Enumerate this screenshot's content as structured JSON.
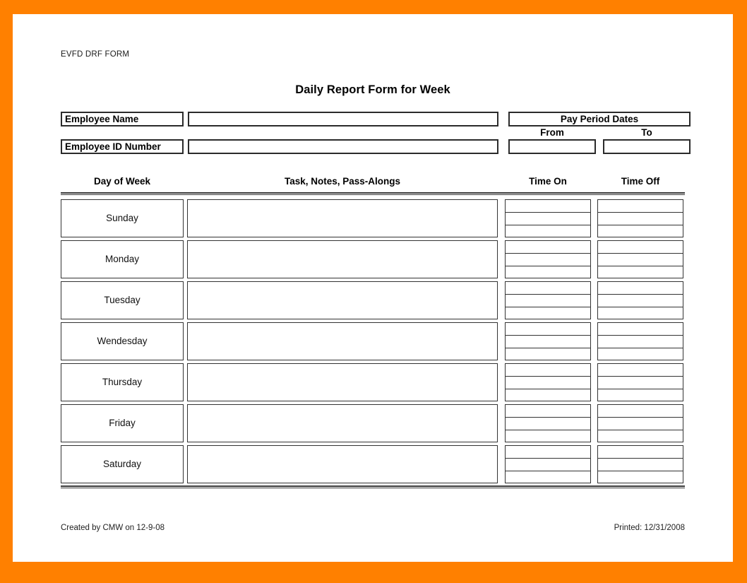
{
  "frame": {
    "border_color": "#ff8000",
    "page_color": "#ffffff"
  },
  "header": {
    "form_code": "EVFD DRF FORM",
    "title": "Daily Report Form for Week"
  },
  "identity": {
    "employee_name_label": "Employee Name",
    "employee_name_value": "",
    "employee_id_label": "Employee ID Number",
    "employee_id_value": "",
    "pay_period_title": "Pay Period Dates",
    "from_label": "From",
    "from_value": "",
    "to_label": "To",
    "to_value": ""
  },
  "table": {
    "columns": [
      "Day of Week",
      "Task, Notes, Pass-Alongs",
      "Time On",
      "Time Off"
    ],
    "time_subrows_per_day": 3,
    "rows": [
      {
        "day": "Sunday",
        "task": "",
        "time_on": [
          "",
          "",
          ""
        ],
        "time_off": [
          "",
          "",
          ""
        ]
      },
      {
        "day": "Monday",
        "task": "",
        "time_on": [
          "",
          "",
          ""
        ],
        "time_off": [
          "",
          "",
          ""
        ]
      },
      {
        "day": "Tuesday",
        "task": "",
        "time_on": [
          "",
          "",
          ""
        ],
        "time_off": [
          "",
          "",
          ""
        ]
      },
      {
        "day": "Wendesday",
        "task": "",
        "time_on": [
          "",
          "",
          ""
        ],
        "time_off": [
          "",
          "",
          ""
        ]
      },
      {
        "day": "Thursday",
        "task": "",
        "time_on": [
          "",
          "",
          ""
        ],
        "time_off": [
          "",
          "",
          ""
        ]
      },
      {
        "day": "Friday",
        "task": "",
        "time_on": [
          "",
          "",
          ""
        ],
        "time_off": [
          "",
          "",
          ""
        ]
      },
      {
        "day": "Saturday",
        "task": "",
        "time_on": [
          "",
          "",
          ""
        ],
        "time_off": [
          "",
          "",
          ""
        ]
      }
    ]
  },
  "footer": {
    "created": "Created by CMW on 12-9-08",
    "printed": "Printed: 12/31/2008"
  }
}
